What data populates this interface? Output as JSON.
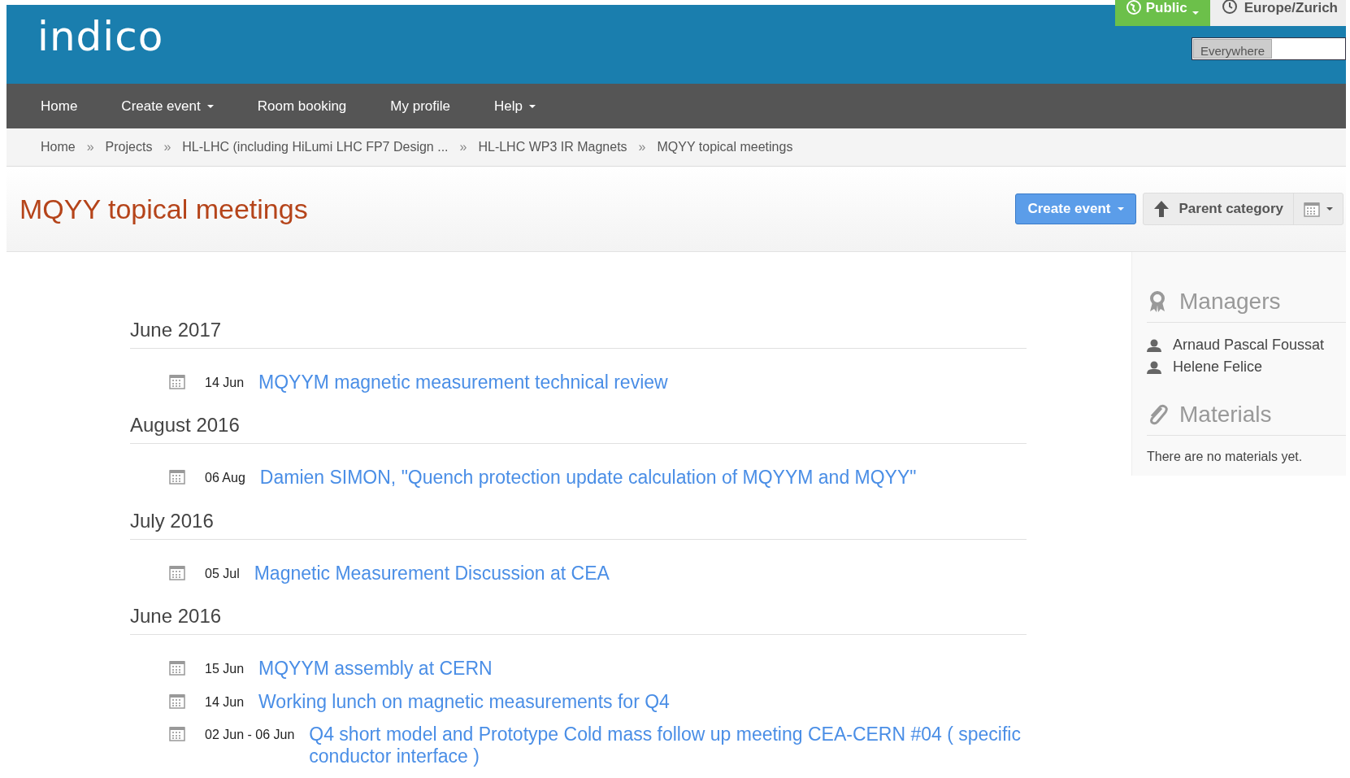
{
  "header": {
    "logo": "indico",
    "protection": "Public",
    "timezone": "Europe/Zurich",
    "search_scope": "Everywhere"
  },
  "nav": [
    {
      "label": "Home",
      "dropdown": false
    },
    {
      "label": "Create event",
      "dropdown": true
    },
    {
      "label": "Room booking",
      "dropdown": false
    },
    {
      "label": "My profile",
      "dropdown": false
    },
    {
      "label": "Help",
      "dropdown": true
    }
  ],
  "breadcrumb_separator": "»",
  "breadcrumb": [
    "Home",
    "Projects",
    "HL-LHC (including HiLumi LHC FP7 Design ...",
    "HL-LHC WP3 IR Magnets",
    "MQYY topical meetings"
  ],
  "page_title": "MQYY topical meetings",
  "toolbar": {
    "create": "Create event",
    "parent": "Parent category"
  },
  "months": [
    {
      "title": "June 2017",
      "events": [
        {
          "date": "14 Jun",
          "title": "MQYYM magnetic measurement technical review"
        }
      ]
    },
    {
      "title": "August 2016",
      "events": [
        {
          "date": "06 Aug",
          "title": "Damien SIMON, \"Quench protection update calculation of MQYYM and MQYY\""
        }
      ]
    },
    {
      "title": "July 2016",
      "events": [
        {
          "date": "05 Jul",
          "title": "Magnetic Measurement Discussion at CEA"
        }
      ]
    },
    {
      "title": "June 2016",
      "events": [
        {
          "date": "15 Jun",
          "title": "MQYYM assembly at CERN"
        },
        {
          "date": "14 Jun",
          "title": "Working lunch on magnetic measurements for Q4"
        },
        {
          "date": "02 Jun - 06 Jun",
          "title": "Q4 short model and Prototype Cold mass follow up meeting CEA-CERN #04 ( specific conductor interface )"
        }
      ]
    }
  ],
  "sidebar": {
    "managers_title": "Managers",
    "managers": [
      "Arnaud Pascal Foussat",
      "Helene Felice"
    ],
    "materials_title": "Materials",
    "materials_empty": "There are no materials yet."
  }
}
